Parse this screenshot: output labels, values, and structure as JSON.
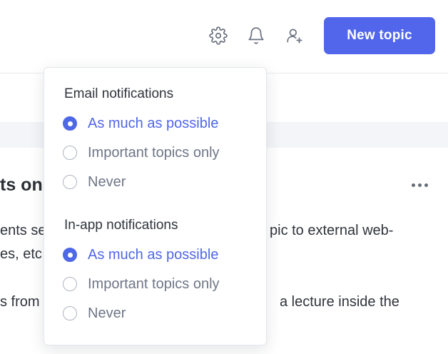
{
  "header": {
    "new_topic_label": "New topic",
    "icons": [
      "gear-icon",
      "bell-icon",
      "add-user-icon"
    ],
    "accent_color": "#5166ea"
  },
  "content": {
    "title_fragment": "ts on",
    "lines": [
      "ents se",
      "pic to external web-",
      "es, etc",
      "s from",
      "a lecture inside the"
    ]
  },
  "popover": {
    "email": {
      "heading": "Email notifications",
      "options": [
        "As much as possible",
        "Important topics only",
        "Never"
      ],
      "selected": "As much as possible"
    },
    "in_app": {
      "heading": "In-app notifications",
      "options": [
        "As much as possible",
        "Important topics only",
        "Never"
      ],
      "selected": "As much as possible"
    }
  }
}
